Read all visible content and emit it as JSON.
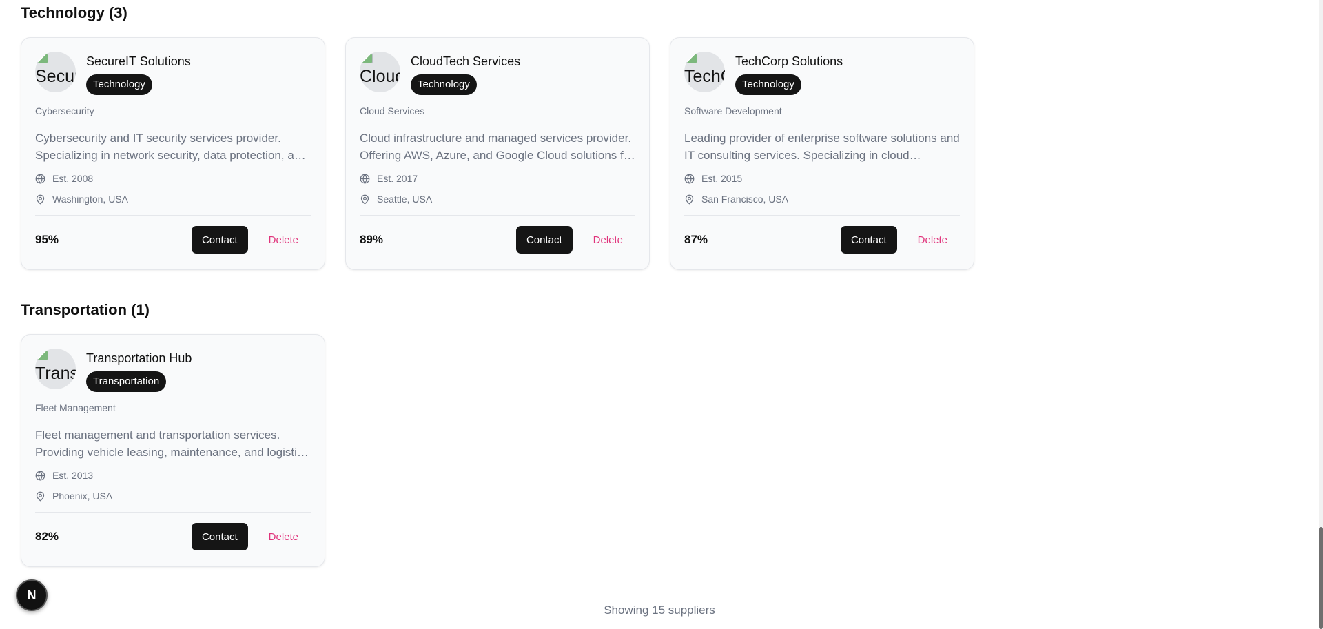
{
  "sections": [
    {
      "title": "Technology (3)",
      "cards": [
        {
          "name": "SecureIT Solutions",
          "avatar_alt": "SecureIT Solutions",
          "badge": "Technology",
          "subcategory": "Cybersecurity",
          "description": "Cybersecurity and IT security services provider. Specializing in network security, data protection, and compliance solutions.",
          "established": "Est. 2008",
          "location": "Washington, USA",
          "score": "95%"
        },
        {
          "name": "CloudTech Services",
          "avatar_alt": "CloudTech Services",
          "badge": "Technology",
          "subcategory": "Cloud Services",
          "description": "Cloud infrastructure and managed services provider. Offering AWS, Azure, and Google Cloud solutions for businesses.",
          "established": "Est. 2017",
          "location": "Seattle, USA",
          "score": "89%"
        },
        {
          "name": "TechCorp Solutions",
          "avatar_alt": "TechCorp Solutions",
          "badge": "Technology",
          "subcategory": "Software Development",
          "description": "Leading provider of enterprise software solutions and IT consulting services. Specializing in cloud computing and digital transformation.",
          "established": "Est. 2015",
          "location": "San Francisco, USA",
          "score": "87%"
        }
      ]
    },
    {
      "title": "Transportation (1)",
      "cards": [
        {
          "name": "Transportation Hub",
          "avatar_alt": "Transportation Hub",
          "badge": "Transportation",
          "subcategory": "Fleet Management",
          "description": "Fleet management and transportation services. Providing vehicle leasing, maintenance, and logistics support.",
          "established": "Est. 2013",
          "location": "Phoenix, USA",
          "score": "82%"
        }
      ]
    }
  ],
  "actions": {
    "contact_label": "Contact",
    "delete_label": "Delete"
  },
  "footer": {
    "showing_text": "Showing 15 suppliers"
  },
  "next_devtools": {
    "letter": "N"
  },
  "colors": {
    "accent_dark": "#151515",
    "delete_pink": "#e0337b",
    "muted_text": "#6b7280",
    "card_bg": "#f9fafb"
  }
}
